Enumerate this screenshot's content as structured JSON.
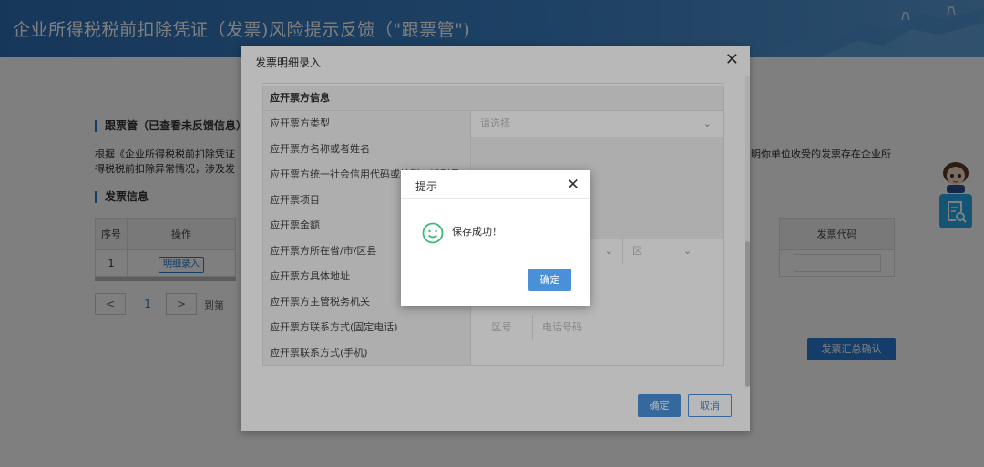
{
  "header": {
    "title": "企业所得税税前扣除凭证（发票)风险提示反馈（\"跟票管\")"
  },
  "background": {
    "section1_title": "跟票管（已查看未反馈信息）",
    "desc_line1_left": "根据《企业所得税税前扣除凭证",
    "desc_line2_left": "得税税前扣除异常情况，涉及发",
    "desc_line1_right": "明你单位收受的发票存在企业所",
    "section2_title": "发票信息",
    "table": {
      "col_index": "序号",
      "col_action": "操作",
      "col_code": "发票代码",
      "row_index": "1",
      "row_action": "明细录入"
    },
    "pager": {
      "prev": "<",
      "page": "1",
      "next": ">",
      "goto_label": "到第"
    },
    "summary_button": "发票汇总确认"
  },
  "dialog": {
    "title": "发票明细录入",
    "section_title": "应开票方信息",
    "rows": [
      {
        "label": "应开票方类型",
        "value": "请选择"
      },
      {
        "label": "应开票方名称或者姓名",
        "value": ""
      },
      {
        "label": "应开票方统一社会信用代码或纳税人识别号",
        "value": ""
      },
      {
        "label": "应开票项目",
        "value": ""
      },
      {
        "label": "应开票金额",
        "value": ""
      },
      {
        "label": "应开票方所在省/市/区县",
        "value": "区"
      },
      {
        "label": "应开票方具体地址",
        "value": ""
      },
      {
        "label": "应开票方主管税务机关",
        "value": ""
      },
      {
        "label": "应开票方联系方式(固定电话)",
        "value_area": "区号",
        "value_phone": "电话号码"
      },
      {
        "label": "应开票联系方式(手机)",
        "value": ""
      }
    ],
    "confirm_label": "确定",
    "cancel_label": "取消"
  },
  "tip": {
    "title": "提示",
    "message": "保存成功！",
    "confirm_label": "确定"
  }
}
